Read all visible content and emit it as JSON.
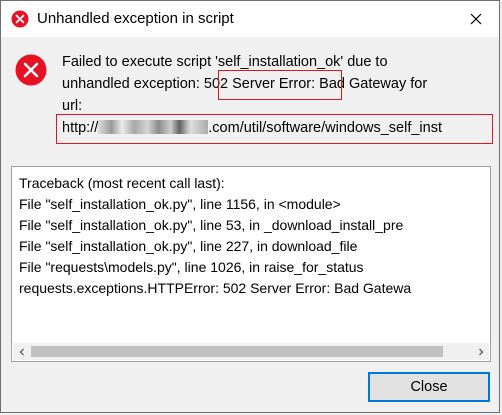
{
  "window": {
    "title": "Unhandled exception in script",
    "title_icon": "error-icon",
    "close_icon": "close-icon"
  },
  "message": {
    "icon": "error-icon",
    "line1": "Failed to execute script 'self_installation_ok' due to",
    "line2_prefix": "unhandled exception: ",
    "line2_highlight": "502 Server Error",
    "line2_suffix": ": Bad Gateway for",
    "line3": "url:",
    "url_prefix": "http://",
    "url_suffix": ".com/util/software/windows_self_inst"
  },
  "traceback": {
    "lines": [
      "Traceback (most recent call last):",
      "  File \"self_installation_ok.py\", line 1156, in <module>",
      "  File \"self_installation_ok.py\", line 53, in _download_install_pre",
      "  File \"self_installation_ok.py\", line 227, in download_file",
      "  File \"requests\\models.py\", line 1026, in raise_for_status",
      "requests.exceptions.HTTPError: 502 Server Error: Bad Gatewa"
    ]
  },
  "buttons": {
    "close_label": "Close"
  },
  "colors": {
    "error_red": "#e81123",
    "highlight_red": "#d71921",
    "button_border": "#0078d7"
  }
}
